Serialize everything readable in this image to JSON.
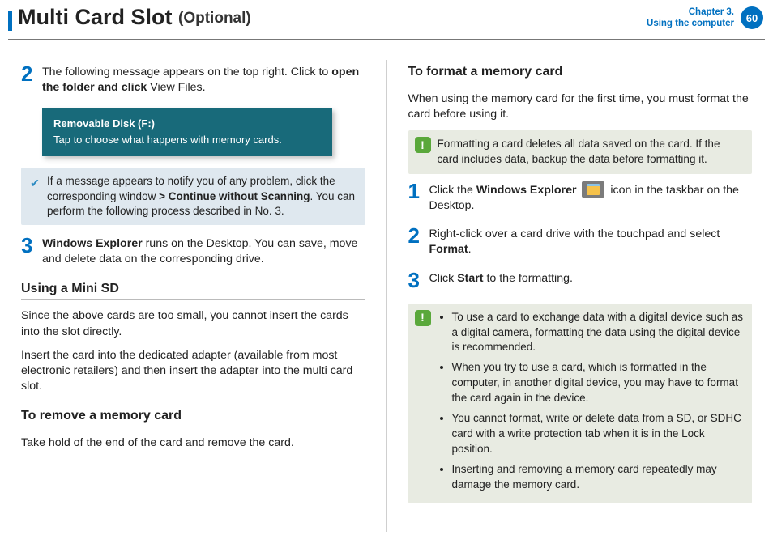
{
  "header": {
    "title": "Multi Card Slot",
    "optional": "(Optional)",
    "chapter_line1": "Chapter 3.",
    "chapter_line2": "Using the computer",
    "page_number": "60"
  },
  "left": {
    "step2_prefix": "The following message appears on the top right. Click to ",
    "step2_bold": "open the folder and click",
    "step2_suffix": " View Files.",
    "toast_title": "Removable Disk (F:)",
    "toast_body": "Tap to choose what happens with memory cards.",
    "note_pre": "If a message appears to notify you of any problem, click the corresponding window ",
    "note_gt": ">",
    "note_bold": " Continue without Scanning",
    "note_post": ". You can perform the following process described in No. 3.",
    "step3_bold": "Windows Explorer",
    "step3_rest": " runs on the Desktop. You can save, move and delete data on the corresponding drive.",
    "h_minisd": "Using a Mini SD",
    "minisd_p1": "Since the above cards are too small, you cannot insert the cards into the slot directly.",
    "minisd_p2": "Insert the card into the dedicated adapter (available from most electronic retailers) and then insert the adapter into the multi card slot.",
    "h_remove": "To remove a memory card",
    "remove_p": "Take hold of the end of the card and remove the card."
  },
  "right": {
    "h_format": "To format a memory card",
    "format_p": "When using the memory card for the first time, you must format the card before using it.",
    "warn": "Formatting a card deletes all data saved on the card. If the card includes data, backup the data before formatting it.",
    "s1_a": "Click the ",
    "s1_b": "Windows Explorer",
    "s1_c": " icon in the taskbar on the Desktop.",
    "s2_a": "Right-click over a card drive with the touchpad and select ",
    "s2_b": "Format",
    "s2_c": ".",
    "s3_a": "Click ",
    "s3_b": "Start",
    "s3_c": " to the formatting.",
    "bul1": "To use a card to exchange data with a digital device such as a digital camera, formatting the data using the digital device is recommended.",
    "bul2": "When you try to use a card, which is formatted in the computer, in another digital device, you may have to format the card again in the device.",
    "bul3": "You cannot format, write or delete data from a SD, or SDHC card with a write protection tab when it is in the Lock position.",
    "bul4": "Inserting and removing a memory card repeatedly may damage the memory card."
  },
  "nums": {
    "n1": "1",
    "n2": "2",
    "n3": "3"
  }
}
